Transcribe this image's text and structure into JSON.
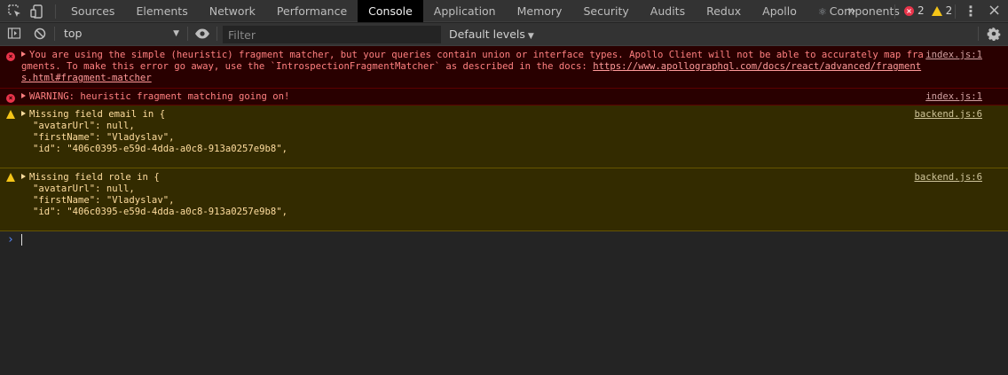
{
  "tabs": [
    {
      "label": "Sources",
      "active": false
    },
    {
      "label": "Elements",
      "active": false
    },
    {
      "label": "Network",
      "active": false
    },
    {
      "label": "Performance",
      "active": false
    },
    {
      "label": "Console",
      "active": true
    },
    {
      "label": "Application",
      "active": false
    },
    {
      "label": "Memory",
      "active": false
    },
    {
      "label": "Security",
      "active": false
    },
    {
      "label": "Audits",
      "active": false
    },
    {
      "label": "Redux",
      "active": false
    },
    {
      "label": "Apollo",
      "active": false
    },
    {
      "label": "Components",
      "active": false,
      "icon": "react-icon"
    }
  ],
  "counters": {
    "errors": "2",
    "warnings": "2"
  },
  "toolbar": {
    "context": "top",
    "filter_placeholder": "Filter",
    "levels": "Default levels"
  },
  "messages": [
    {
      "level": "error",
      "text": "You are using the simple (heuristic) fragment matcher, but your queries contain union or interface types. Apollo Client will not be able to accurately map fragments. To make this error go away, use the `IntrospectionFragmentMatcher` as described in the docs: ",
      "link": "https://www.apollographql.com/docs/react/advanced/fragments.html#fragment-matcher",
      "source": "index.js:1"
    },
    {
      "level": "error",
      "text": "WARNING: heuristic fragment matching going on!",
      "source": "index.js:1"
    },
    {
      "level": "warning",
      "text": "Missing field email in {",
      "lines": [
        "\"avatarUrl\": null,",
        "\"firstName\": \"Vladyslav\",",
        "\"id\": \"406c0395-e59d-4dda-a0c8-913a0257e9b8\","
      ],
      "source": "backend.js:6"
    },
    {
      "level": "warning",
      "text": "Missing field role in {",
      "lines": [
        "\"avatarUrl\": null,",
        "\"firstName\": \"Vladyslav\",",
        "\"id\": \"406c0395-e59d-4dda-a0c8-913a0257e9b8\","
      ],
      "source": "backend.js:6"
    }
  ],
  "colors": {
    "error_bg": "#290000",
    "warning_bg": "#332b00",
    "active_tab_bg": "#000000",
    "prompt_accent": "#5a8cff"
  }
}
